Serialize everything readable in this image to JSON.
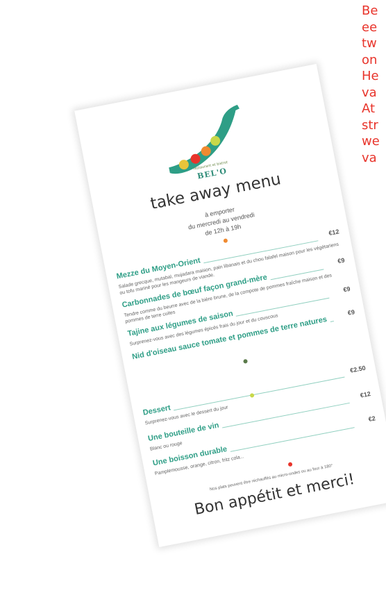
{
  "side_text": [
    "Be",
    "ee",
    "tw",
    "on",
    "He",
    "va",
    "At",
    "str",
    "we",
    "va"
  ],
  "logo": {
    "tagline": "restaurant et bistrot",
    "brand": "BEL'O",
    "pod_color": "#2e9e86",
    "pea_colors": [
      "#e8c43a",
      "#e8342b",
      "#f08a30",
      "#c8d84a"
    ]
  },
  "menu": {
    "title": "take away menu",
    "subtitle": [
      "à emporter",
      "du mercredi au vendredi",
      "de 12h à 19h"
    ],
    "items": [
      {
        "name": "Mezze du Moyen-Orient",
        "price": "€12",
        "desc": "Salade grecque, mutabal, mujadara maison, pain libanais et du chou falafel maison pour les végétariens ou tofu mariné pour les mangeurs de viande."
      },
      {
        "name": "Carbonnades de bœuf façon grand-mère",
        "price": "€9",
        "desc": "Tendre comme du beurre avec de la bière brune, de la compote de pommes fraîche maison et des pommes de terre cuites"
      },
      {
        "name": "Tajine aux légumes de saison",
        "price": "€9",
        "desc": "Surprenez-vous avec des légumes épicés frais du jour et du couscous"
      },
      {
        "name": "Nid d'oiseau sauce tomate et pommes de terre natures",
        "price": "€9",
        "desc": ""
      },
      {
        "name": "Dessert",
        "price": "€2.50",
        "desc": "Surprenez-vous avec le dessert du jour"
      },
      {
        "name": "Une bouteille de vin",
        "price": "€12",
        "desc": "Blanc ou rouge"
      },
      {
        "name": "Une boisson durable",
        "price": "€2",
        "desc": "Pamplemousse, orange, citron, fritz cola..."
      }
    ],
    "note": "Nos plats peuvent être réchauffés au micro-ondes ou au four à 180°",
    "closing": "Bon appétit et merci!"
  },
  "colors": {
    "accent": "#2e9e86",
    "side_text": "#e8342b"
  }
}
